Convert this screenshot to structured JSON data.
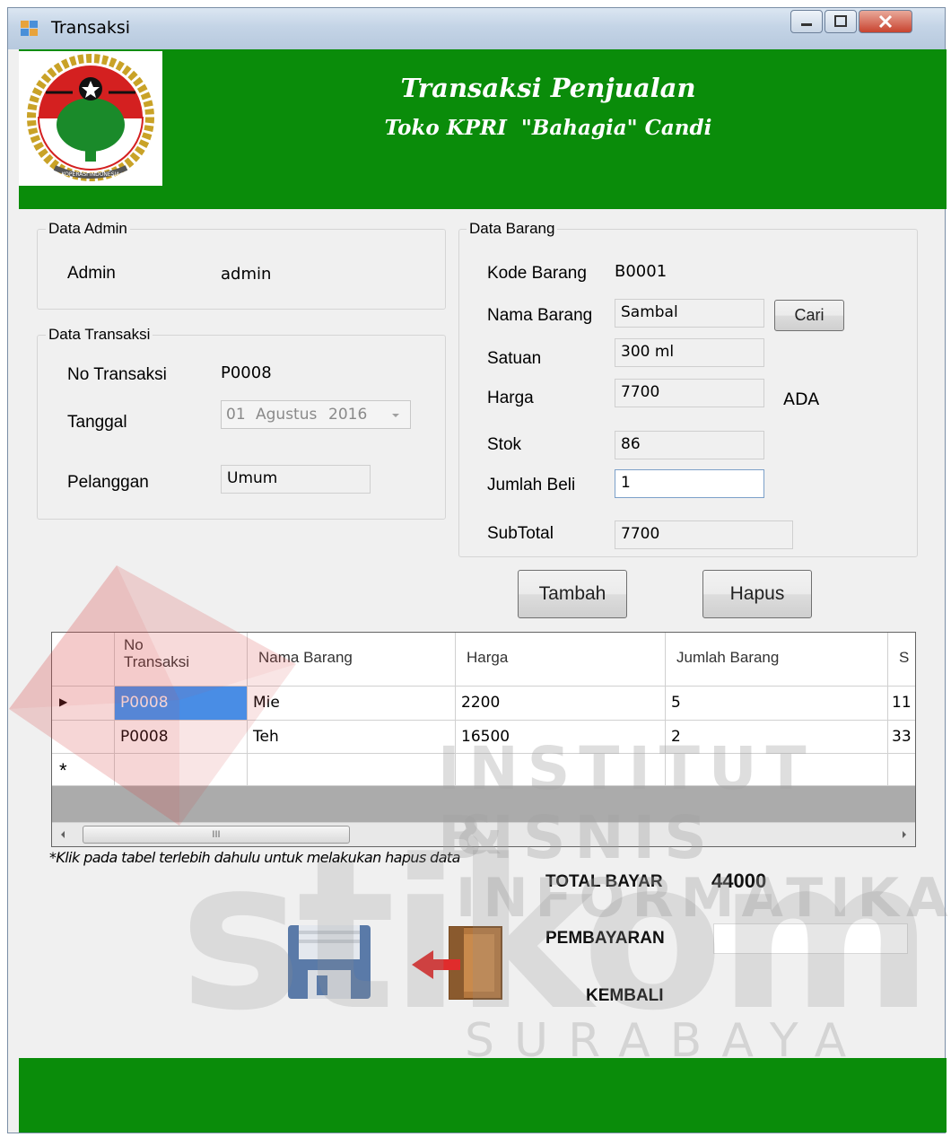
{
  "window": {
    "title": "Transaksi"
  },
  "header": {
    "title": "Transaksi Penjualan",
    "subtitle": "Toko KPRI  \"Bahagia\" Candi",
    "logo_text": "KOPERASI INDONESIA"
  },
  "data_admin": {
    "group_title": "Data Admin",
    "admin_label": "Admin",
    "admin_value": "admin"
  },
  "data_transaksi": {
    "group_title": "Data Transaksi",
    "no_label": "No Transaksi",
    "no_value": "P0008",
    "tanggal_label": "Tanggal",
    "tanggal_day": "01",
    "tanggal_month": "Agustus",
    "tanggal_year": "2016",
    "pelanggan_label": "Pelanggan",
    "pelanggan_value": "Umum"
  },
  "data_barang": {
    "group_title": "Data Barang",
    "kode_label": "Kode Barang",
    "kode_value": "B0001",
    "nama_label": "Nama Barang",
    "nama_value": "Sambal",
    "cari_button": "Cari",
    "satuan_label": "Satuan",
    "satuan_value": "300 ml",
    "harga_label": "Harga",
    "harga_value": "7700",
    "status_text": "ADA",
    "stok_label": "Stok",
    "stok_value": "86",
    "jumlah_label": "Jumlah Beli",
    "jumlah_value": "1",
    "subtotal_label": "SubTotal",
    "subtotal_value": "7700"
  },
  "buttons": {
    "tambah": "Tambah",
    "hapus": "Hapus"
  },
  "grid": {
    "columns": [
      "No\nTransaksi",
      "Nama Barang",
      "Harga",
      "Jumlah Barang",
      "S"
    ],
    "rows": [
      [
        "P0008",
        "Mie",
        "2200",
        "5",
        "11"
      ],
      [
        "P0008",
        "Teh",
        "16500",
        "2",
        "33"
      ]
    ],
    "new_row_marker": "*",
    "current_row_marker": "▶",
    "scroll_grip": "III"
  },
  "hint": "*Klik pada tabel terlebih dahulu untuk melakukan hapus data",
  "totals": {
    "total_label": "TOTAL BAYAR",
    "total_value": "44000",
    "pembayaran_label": "PEMBAYARAN",
    "pembayaran_value": "",
    "kembali_label": "KEMBALI"
  },
  "watermark": {
    "line1": "INSTITUT BISNIS",
    "line2": "& INFORMATIKA",
    "line3": "stikom",
    "line4": "SURABAYA"
  },
  "colors": {
    "brand_green": "#0a8c0a",
    "selection_blue": "#3399ff"
  }
}
